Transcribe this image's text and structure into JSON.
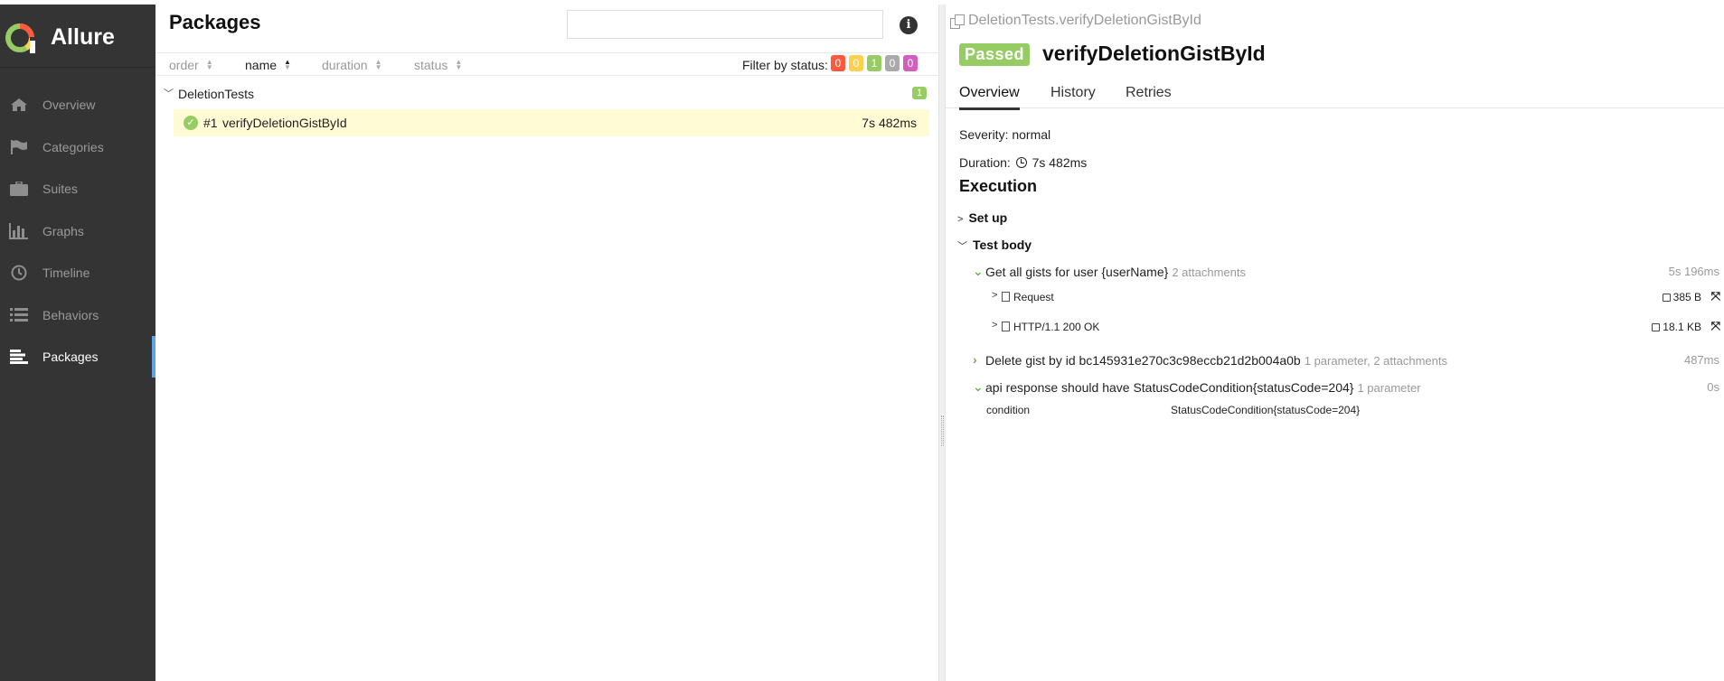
{
  "sidebar": {
    "brand": "Allure",
    "items": [
      {
        "label": "Overview",
        "icon": "home-icon"
      },
      {
        "label": "Categories",
        "icon": "flag-icon"
      },
      {
        "label": "Suites",
        "icon": "briefcase-icon"
      },
      {
        "label": "Graphs",
        "icon": "bar-chart-icon"
      },
      {
        "label": "Timeline",
        "icon": "clock-icon"
      },
      {
        "label": "Behaviors",
        "icon": "list-icon"
      },
      {
        "label": "Packages",
        "icon": "align-left-icon",
        "active": true
      }
    ]
  },
  "packages": {
    "title": "Packages",
    "search_value": "",
    "sort": {
      "order": "order",
      "name": "name",
      "duration": "duration",
      "status": "status"
    },
    "filter_label": "Filter by status:",
    "status_counts": [
      {
        "value": "0",
        "color": "#fd5a3e"
      },
      {
        "value": "0",
        "color": "#ffd050"
      },
      {
        "value": "1",
        "color": "#97cc64"
      },
      {
        "value": "0",
        "color": "#aaaaaa"
      },
      {
        "value": "0",
        "color": "#d35ebe"
      }
    ],
    "group": {
      "name": "DeletionTests",
      "count": "1"
    },
    "test": {
      "id": "#1",
      "name": "verifyDeletionGistById",
      "duration": "7s 482ms"
    }
  },
  "detail": {
    "breadcrumb": "DeletionTests.verifyDeletionGistById",
    "status": "Passed",
    "title": "verifyDeletionGistById",
    "tabs": [
      "Overview",
      "History",
      "Retries"
    ],
    "severity": "Severity: normal",
    "duration_label": "Duration:",
    "duration_value": "7s 482ms",
    "execution_title": "Execution",
    "setup_label": "Set up",
    "body_label": "Test body",
    "steps": [
      {
        "text": "Get all gists for user {userName}",
        "meta": "2 attachments",
        "duration": "5s 196ms"
      },
      {
        "text": "Delete gist by id bc145931e270c3c98eccb21d2b004a0b",
        "meta": "1 parameter, 2 attachments",
        "duration": "487ms"
      },
      {
        "text": "api response should have StatusCodeCondition{statusCode=204}",
        "meta": "1 parameter",
        "duration": "0s"
      }
    ],
    "attachments": [
      {
        "name": "Request",
        "size": "385 B"
      },
      {
        "name": "HTTP/1.1 200 OK",
        "size": "18.1 KB"
      }
    ],
    "param": {
      "name": "condition",
      "value": "StatusCodeCondition{statusCode=204}"
    }
  },
  "colors": {
    "sidebar_bg": "#343434",
    "accent": "#62a2ea",
    "passed": "#97cc64",
    "row_highlight": "#fffcd5"
  }
}
